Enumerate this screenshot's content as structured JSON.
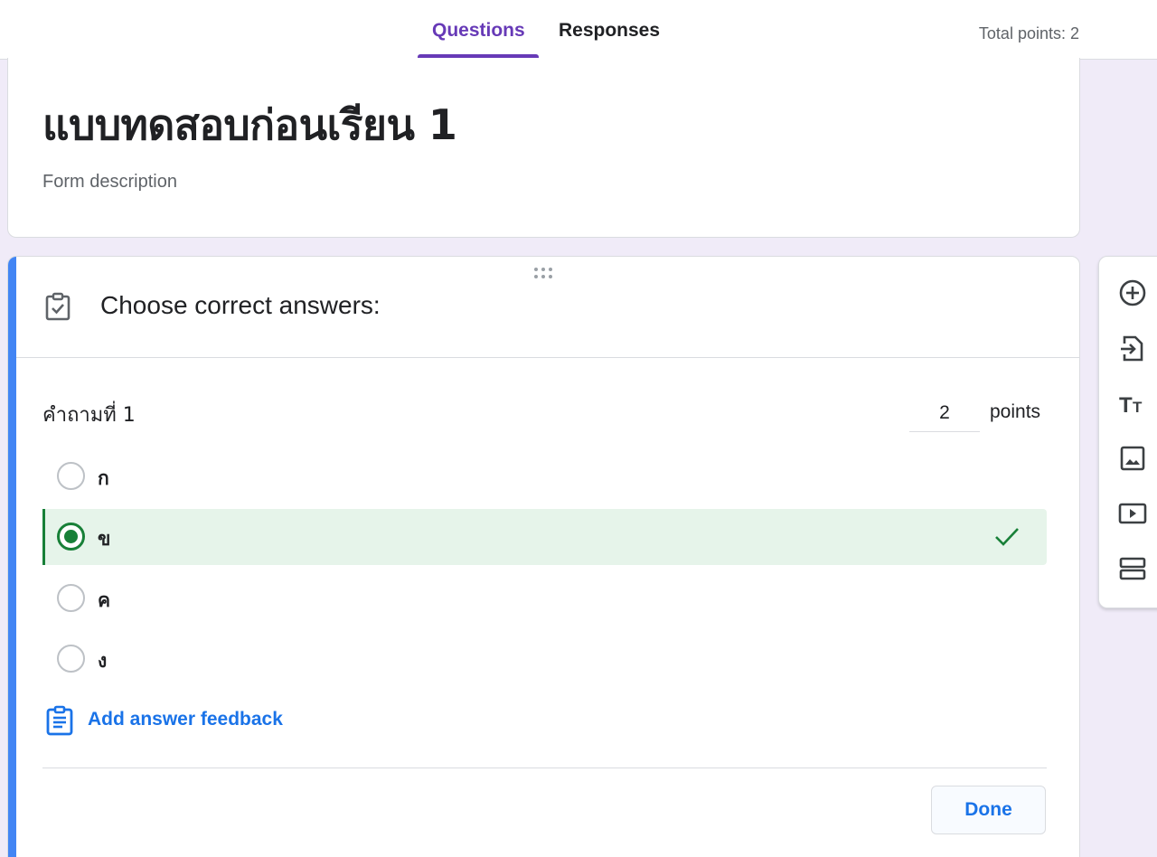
{
  "tabs": [
    {
      "label": "Questions",
      "active": true
    },
    {
      "label": "Responses",
      "active": false
    }
  ],
  "total_points": "Total points: 2",
  "form": {
    "title": "แบบทดสอบก่อนเรียน 1",
    "description_placeholder": "Form description"
  },
  "answer_key": {
    "header": "Choose correct answers:",
    "question_title": "คำถามที่ 1",
    "points_value": "2",
    "points_label": "points",
    "options": [
      {
        "label": "ก",
        "correct": false
      },
      {
        "label": "ข",
        "correct": true
      },
      {
        "label": "ค",
        "correct": false
      },
      {
        "label": "ง",
        "correct": false
      }
    ],
    "feedback_label": "Add answer feedback",
    "done_label": "Done"
  },
  "toolbar": {
    "items": [
      "add-question-icon",
      "import-questions-icon",
      "add-title-icon",
      "add-image-icon",
      "add-video-icon",
      "add-section-icon"
    ]
  },
  "colors": {
    "accent": "#673ab7",
    "card_accent": "#4285f4",
    "correct": "#188038",
    "correct_bg": "#e6f4ea",
    "link": "#1a73e8",
    "page_bg": "#f0ebf8"
  }
}
